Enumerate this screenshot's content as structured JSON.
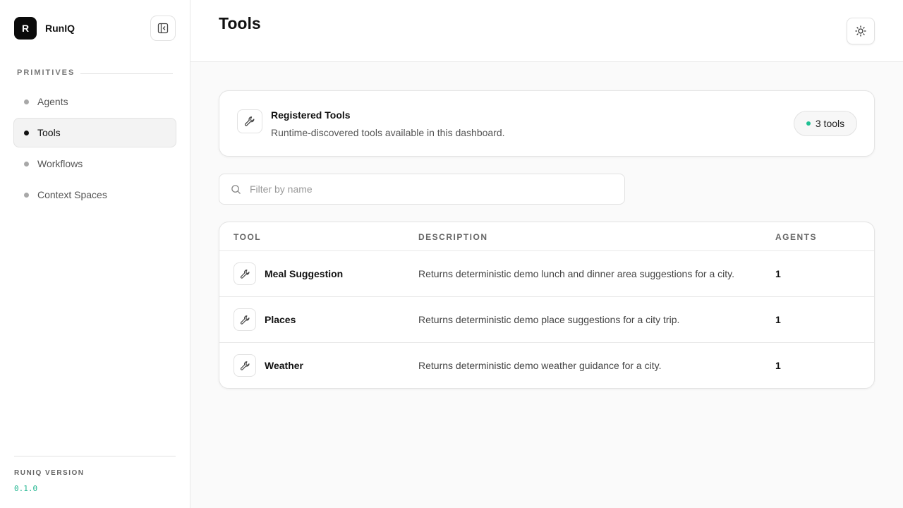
{
  "brand": {
    "logo_letter": "R",
    "name": "RunIQ"
  },
  "sidebar": {
    "section_label": "PRIMITIVES",
    "items": [
      {
        "label": "Agents",
        "active": false
      },
      {
        "label": "Tools",
        "active": true
      },
      {
        "label": "Workflows",
        "active": false
      },
      {
        "label": "Context Spaces",
        "active": false
      }
    ],
    "footer": {
      "version_label": "RUNIQ VERSION",
      "version": "0.1.0"
    }
  },
  "header": {
    "title": "Tools"
  },
  "summary": {
    "title": "Registered Tools",
    "subtitle": "Runtime-discovered tools available in this dashboard.",
    "count_label": "3 tools"
  },
  "search": {
    "placeholder": "Filter by name",
    "value": ""
  },
  "table": {
    "columns": [
      "TOOL",
      "DESCRIPTION",
      "AGENTS"
    ],
    "rows": [
      {
        "name": "Meal Suggestion",
        "description": "Returns deterministic demo lunch and dinner area suggestions for a city.",
        "agents": "1"
      },
      {
        "name": "Places",
        "description": "Returns deterministic demo place suggestions for a city trip.",
        "agents": "1"
      },
      {
        "name": "Weather",
        "description": "Returns deterministic demo weather guidance for a city.",
        "agents": "1"
      }
    ]
  },
  "colors": {
    "accent": "#1fc093",
    "version_text": "#1fb58f",
    "logo_bg": "#0b0b0b"
  },
  "icons": {
    "collapse": "sidebar-collapse-icon",
    "theme": "sun-icon",
    "tool": "wrench-icon",
    "search": "search-icon"
  }
}
